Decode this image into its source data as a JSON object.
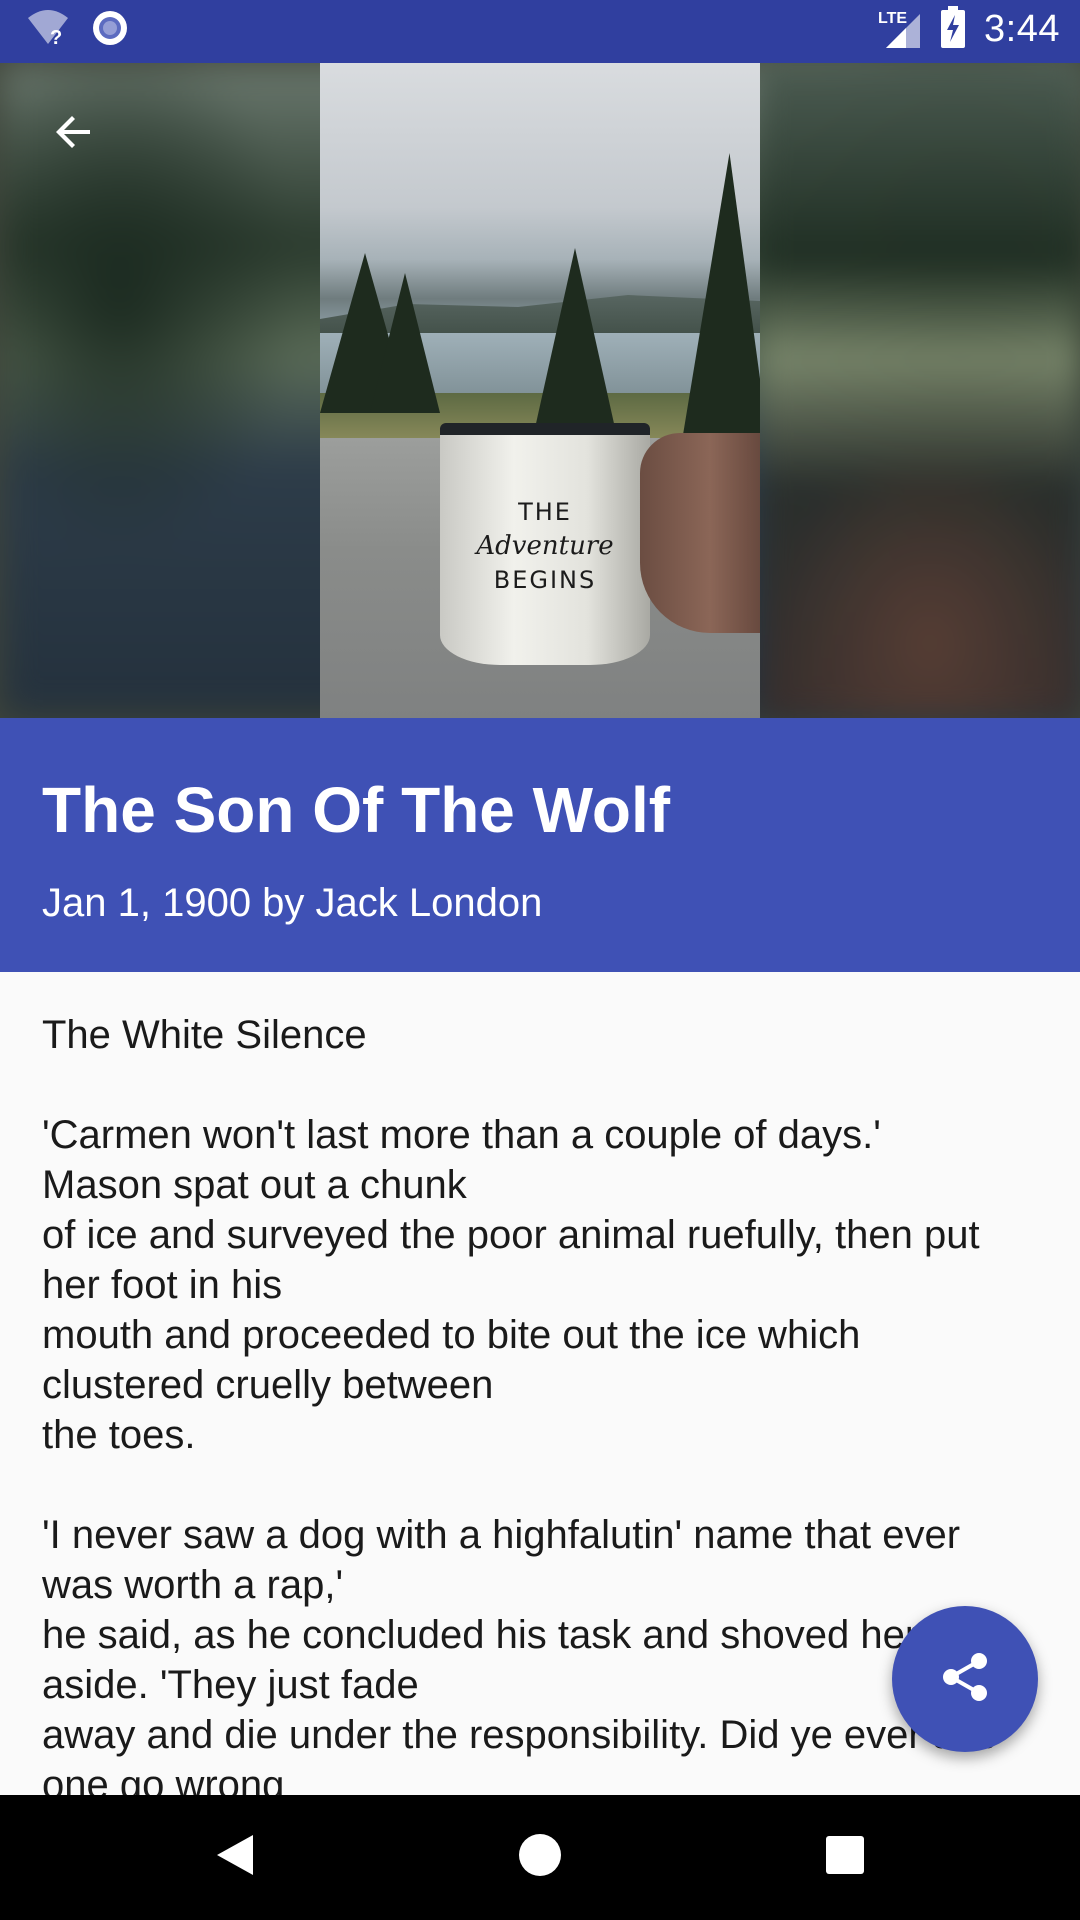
{
  "status_bar": {
    "time": "3:44",
    "network_label": "LTE",
    "icons": [
      "wifi-unknown-icon",
      "sync-icon",
      "signal-icon",
      "battery-charging-icon"
    ],
    "color": "#303f9f"
  },
  "hero": {
    "mug_line1": "THE",
    "mug_line2": "Adventure",
    "mug_line3": "BEGINS"
  },
  "header": {
    "back_icon": "arrow-back-icon",
    "title": "The Son Of The Wolf",
    "meta": "Jan 1, 1900 by Jack London",
    "color": "#3f51b5"
  },
  "content": {
    "text": "The White Silence\n\n'Carmen won't last more than a couple of days.'\nMason spat out a chunk\nof ice and surveyed the poor animal ruefully, then put\nher foot in his\nmouth and proceeded to bite out the ice which\nclustered cruelly between\nthe toes.\n\n'I never saw a dog with a highfalutin' name that ever\nwas worth a rap,'\nhe said, as he concluded his task and shoved her\naside. 'They just fade\naway and die under the responsibility. Did ye ever see\none go wrong"
  },
  "fab": {
    "icon": "share-icon"
  },
  "nav_bar": {
    "icons": [
      "back-triangle-icon",
      "home-circle-icon",
      "recents-square-icon"
    ]
  }
}
